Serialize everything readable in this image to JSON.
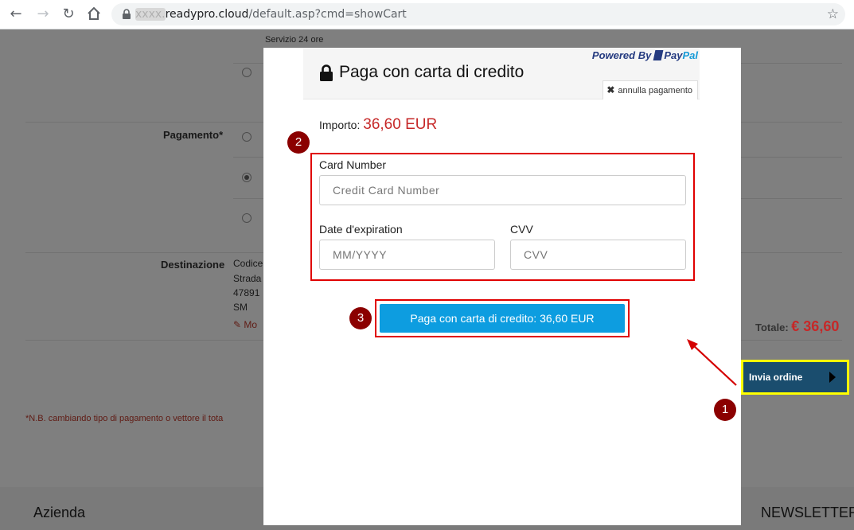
{
  "browser": {
    "url_host_blurred": "xxxx.",
    "url_host": "readypro.cloud",
    "url_path": "/default.asp?cmd=showCart"
  },
  "page": {
    "shipping_note": "Servizio 24 ore",
    "pagamento_label": "Pagamento*",
    "destinazione_label": "Destinazione",
    "destinazione_lines": [
      "Codice",
      "Strada",
      "47891",
      "SM"
    ],
    "modifica_link": "Mo",
    "totale_label": "Totale:",
    "totale_value": "€ 36,60",
    "note": "*N.B. cambiando tipo di pagamento o vettore il tota",
    "invia_label": "Invia ordine",
    "footer_left": "Azienda",
    "footer_right": "NEWSLETTER"
  },
  "modal": {
    "title": "Paga con carta di credito",
    "powered_by": "Powered By",
    "paypal_pay": "Pay",
    "paypal_pal": "Pal",
    "cancel_label": "annulla pagamento",
    "importo_label": "Importo:",
    "importo_value": "36,60 EUR",
    "card_number_label": "Card Number",
    "card_number_placeholder": "Credit Card Number",
    "expiry_label": "Date d'expiration",
    "expiry_placeholder": "MM/YYYY",
    "cvv_label": "CVV",
    "cvv_placeholder": "CVV",
    "pay_button": "Paga con carta di credito: 36,60 EUR"
  },
  "annotations": {
    "step1": "1",
    "step2": "2",
    "step3": "3"
  },
  "colors": {
    "accent_button": "#0d9de0",
    "highlight_red": "#e00000",
    "highlight_yellow": "#ffff00",
    "amount_red": "#c62828",
    "badge": "#8b0000"
  }
}
